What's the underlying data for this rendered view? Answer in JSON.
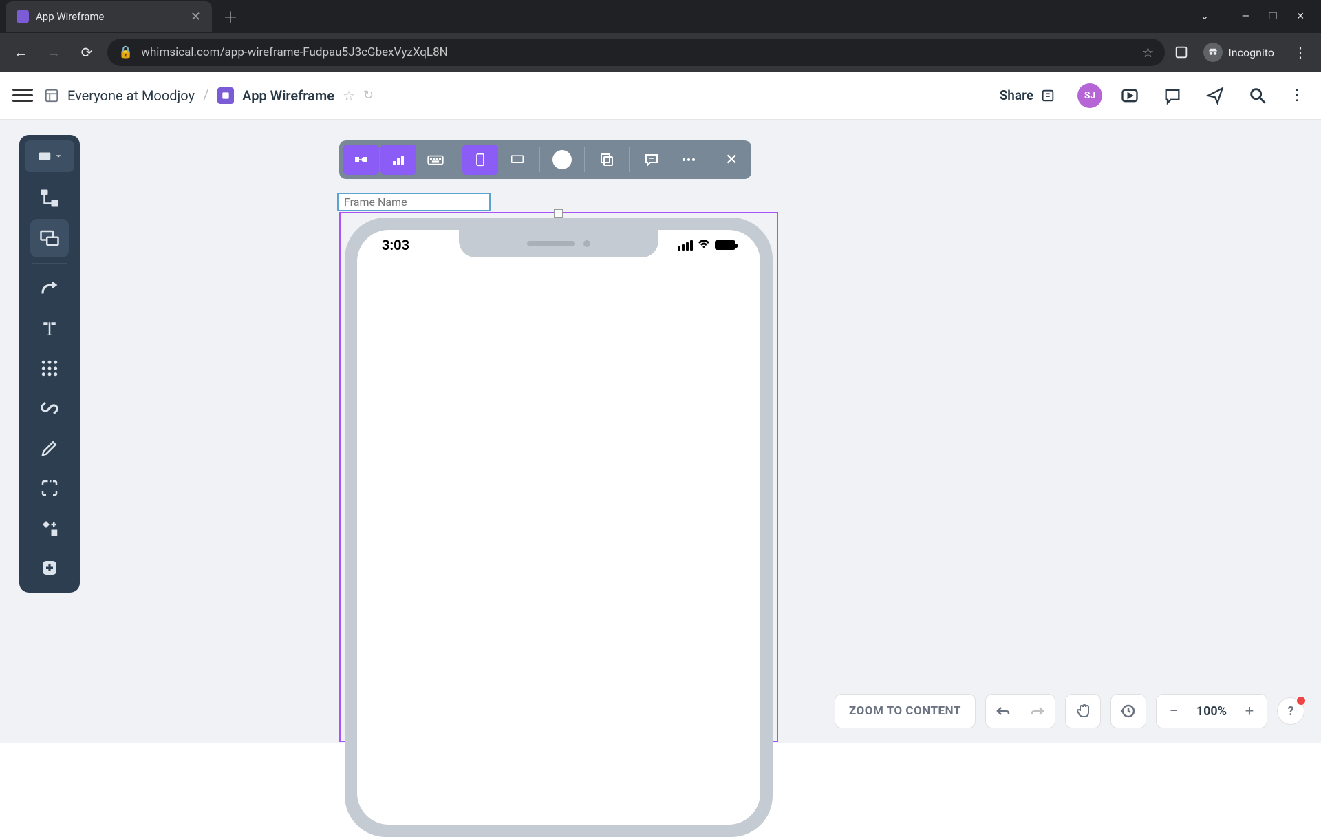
{
  "browser": {
    "tab_title": "App Wireframe",
    "url": "whimsical.com/app-wireframe-Fudpau5J3cGbexVyzXqL8N",
    "incognito_label": "Incognito"
  },
  "header": {
    "workspace": "Everyone at Moodjoy",
    "doc_title": "App Wireframe",
    "share_label": "Share",
    "avatar_initials": "SJ"
  },
  "canvas": {
    "frame_name_placeholder": "Frame Name",
    "phone_time": "3:03"
  },
  "footer": {
    "zoom_to_content": "ZOOM TO CONTENT",
    "zoom_level": "100%",
    "help": "?"
  }
}
